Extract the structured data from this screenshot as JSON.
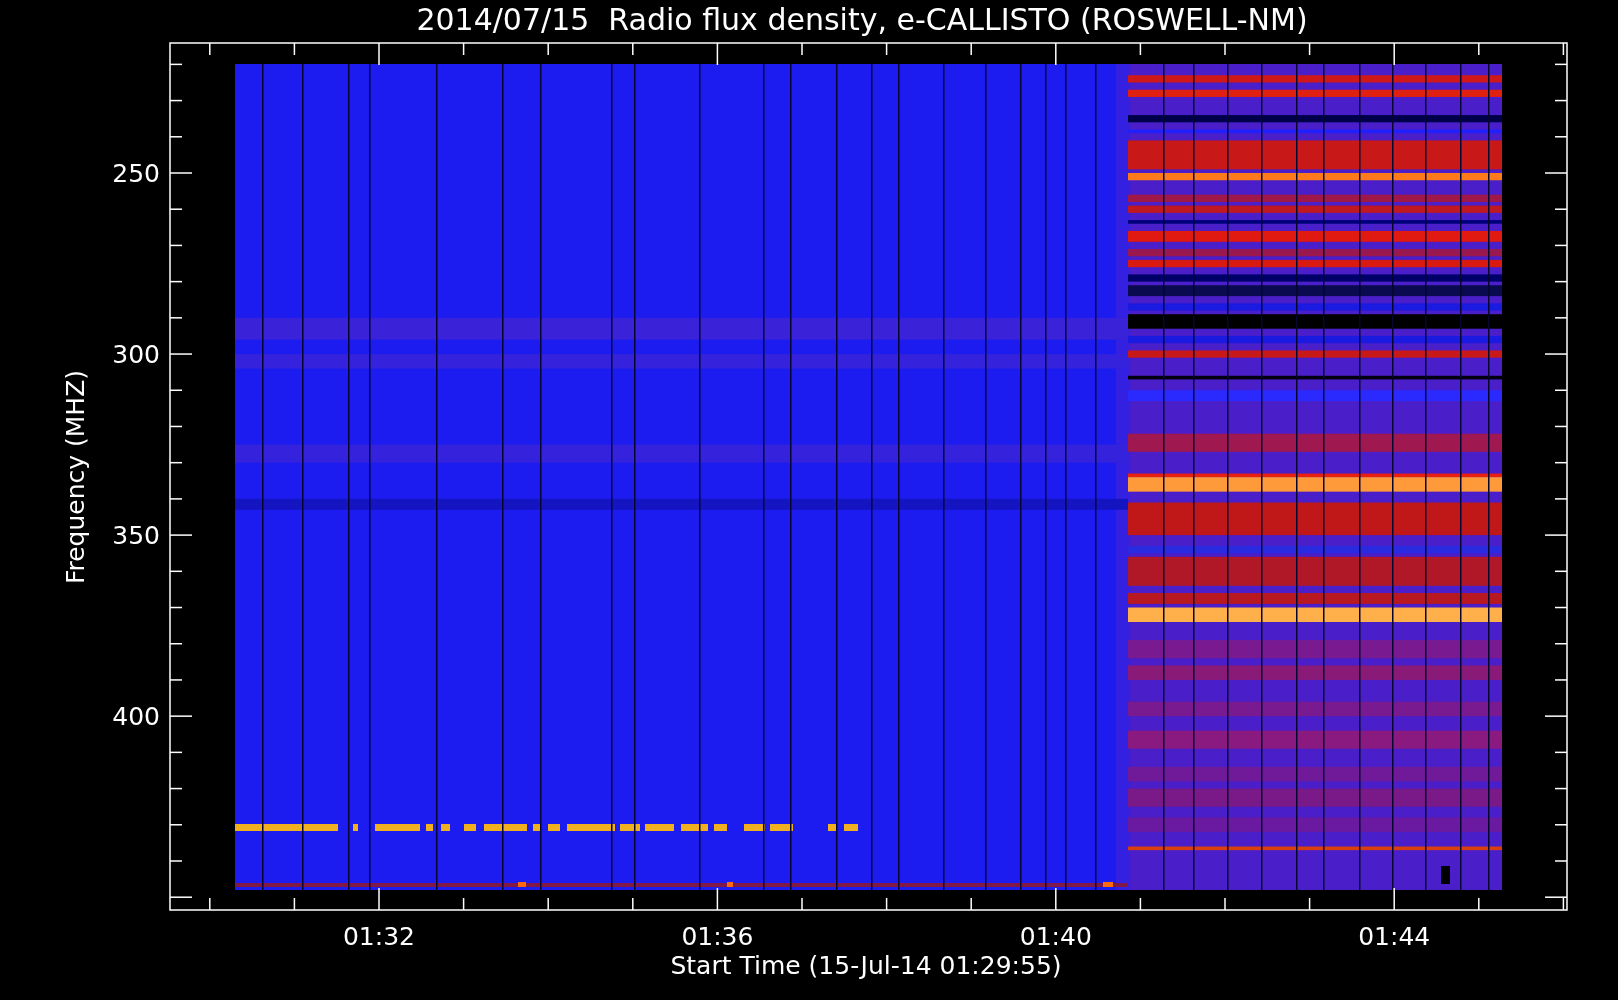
{
  "title": "2014/07/15  Radio flux density, e-CALLISTO (ROSWELL-NM)",
  "y_axis": {
    "label": "Frequency (MHZ)",
    "ticks": [
      "250",
      "300",
      "350",
      "400"
    ]
  },
  "x_axis": {
    "label": "Start Time (15-Jul-14 01:29:55)",
    "ticks": [
      "01:32",
      "01:36",
      "01:40",
      "01:44"
    ]
  }
}
